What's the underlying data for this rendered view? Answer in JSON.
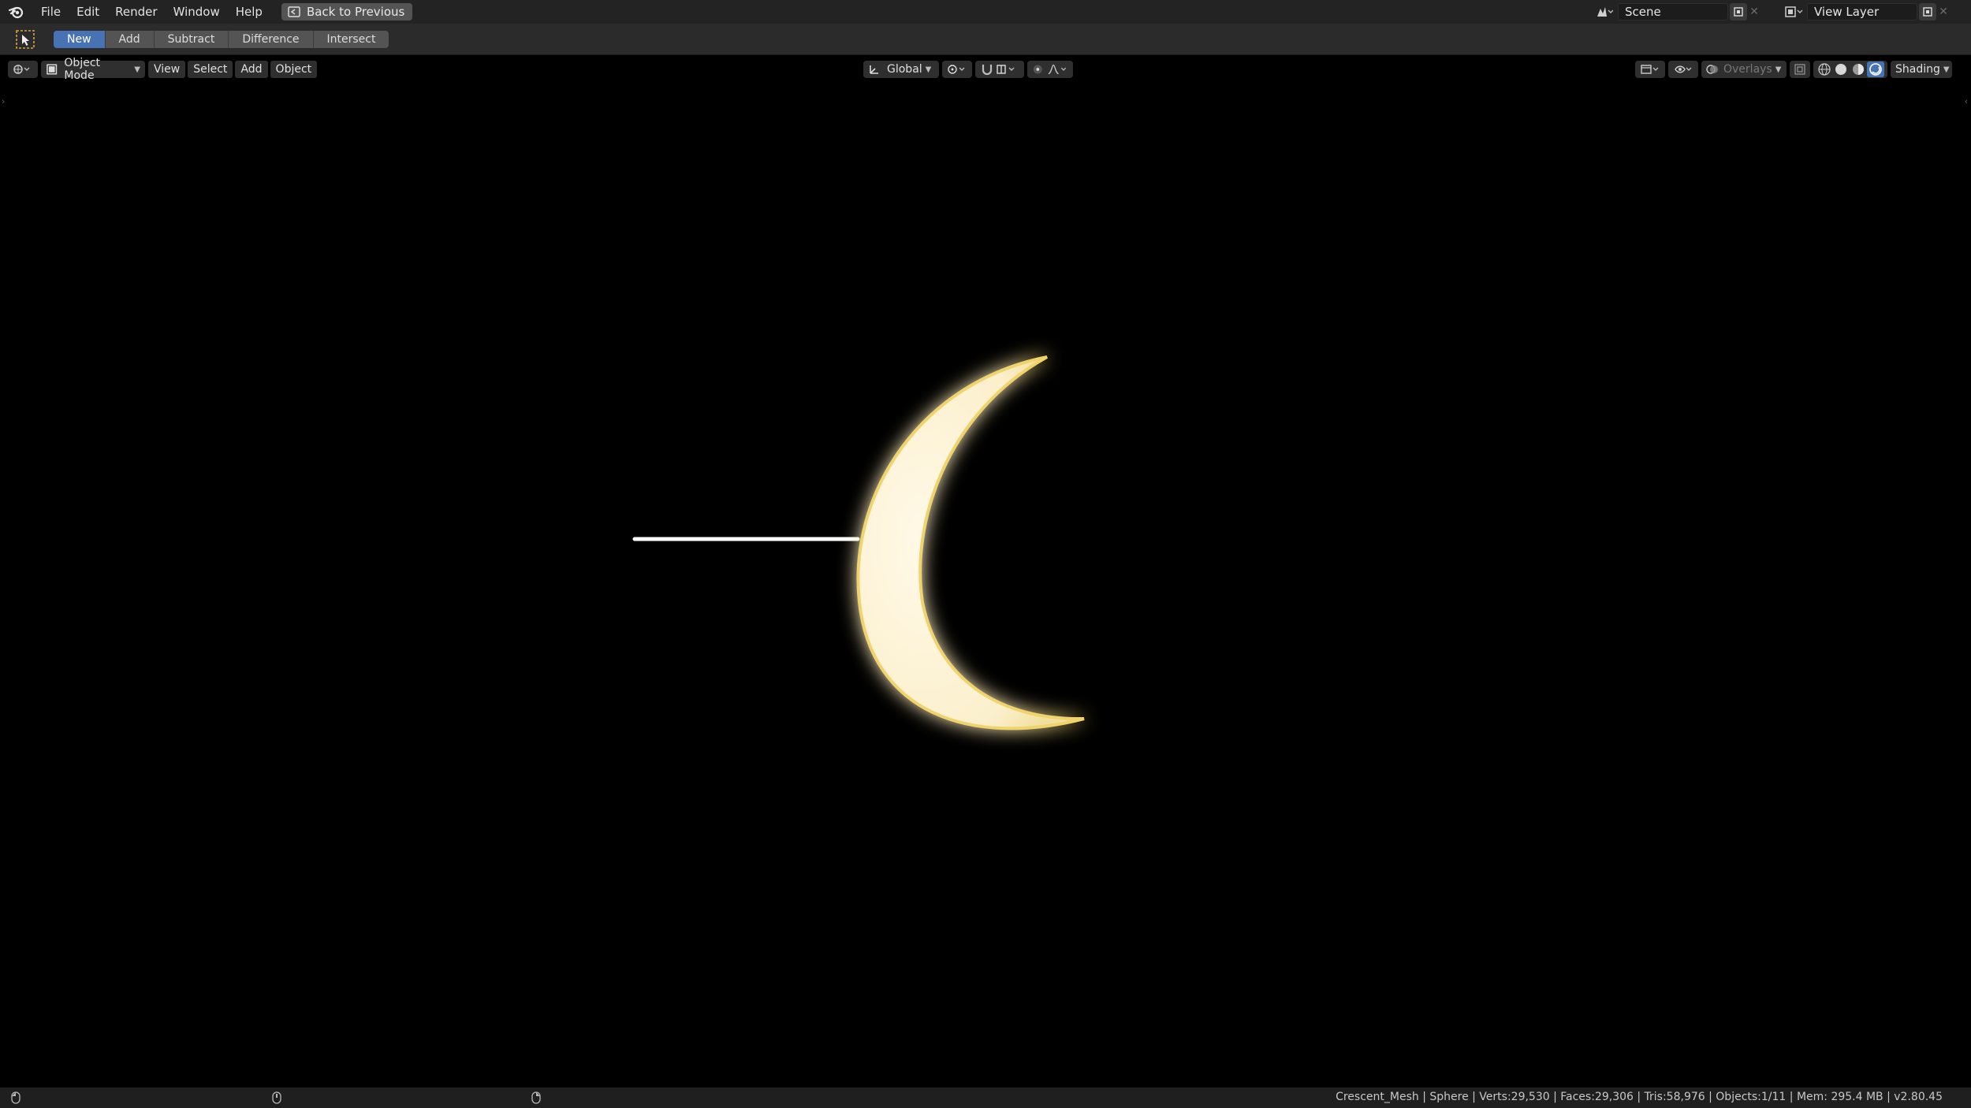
{
  "menu": {
    "items": [
      "File",
      "Edit",
      "Render",
      "Window",
      "Help"
    ],
    "back_label": "Back to Previous"
  },
  "scene": {
    "label": "Scene"
  },
  "view_layer": {
    "label": "View Layer"
  },
  "tool_header": {
    "modes": [
      "New",
      "Add",
      "Subtract",
      "Difference",
      "Intersect"
    ],
    "active_mode": "New"
  },
  "viewport_header": {
    "object_mode": "Object Mode",
    "menus": [
      "View",
      "Select",
      "Add",
      "Object"
    ],
    "transform_orientation": "Global",
    "overlays_label": "Overlays",
    "shading_label": "Shading"
  },
  "status": {
    "stats": "Crescent_Mesh | Sphere | Verts:29,530 | Faces:29,306 | Tris:58,976 | Objects:1/11 | Mem: 295.4 MB | v2.80.45"
  },
  "colors": {
    "accent": "#4772b3",
    "crescent": "#fdf3d6",
    "crescent_glow": "#f2d25a",
    "beam": "#ffffff",
    "beam_glow": "#7ec4e8"
  }
}
